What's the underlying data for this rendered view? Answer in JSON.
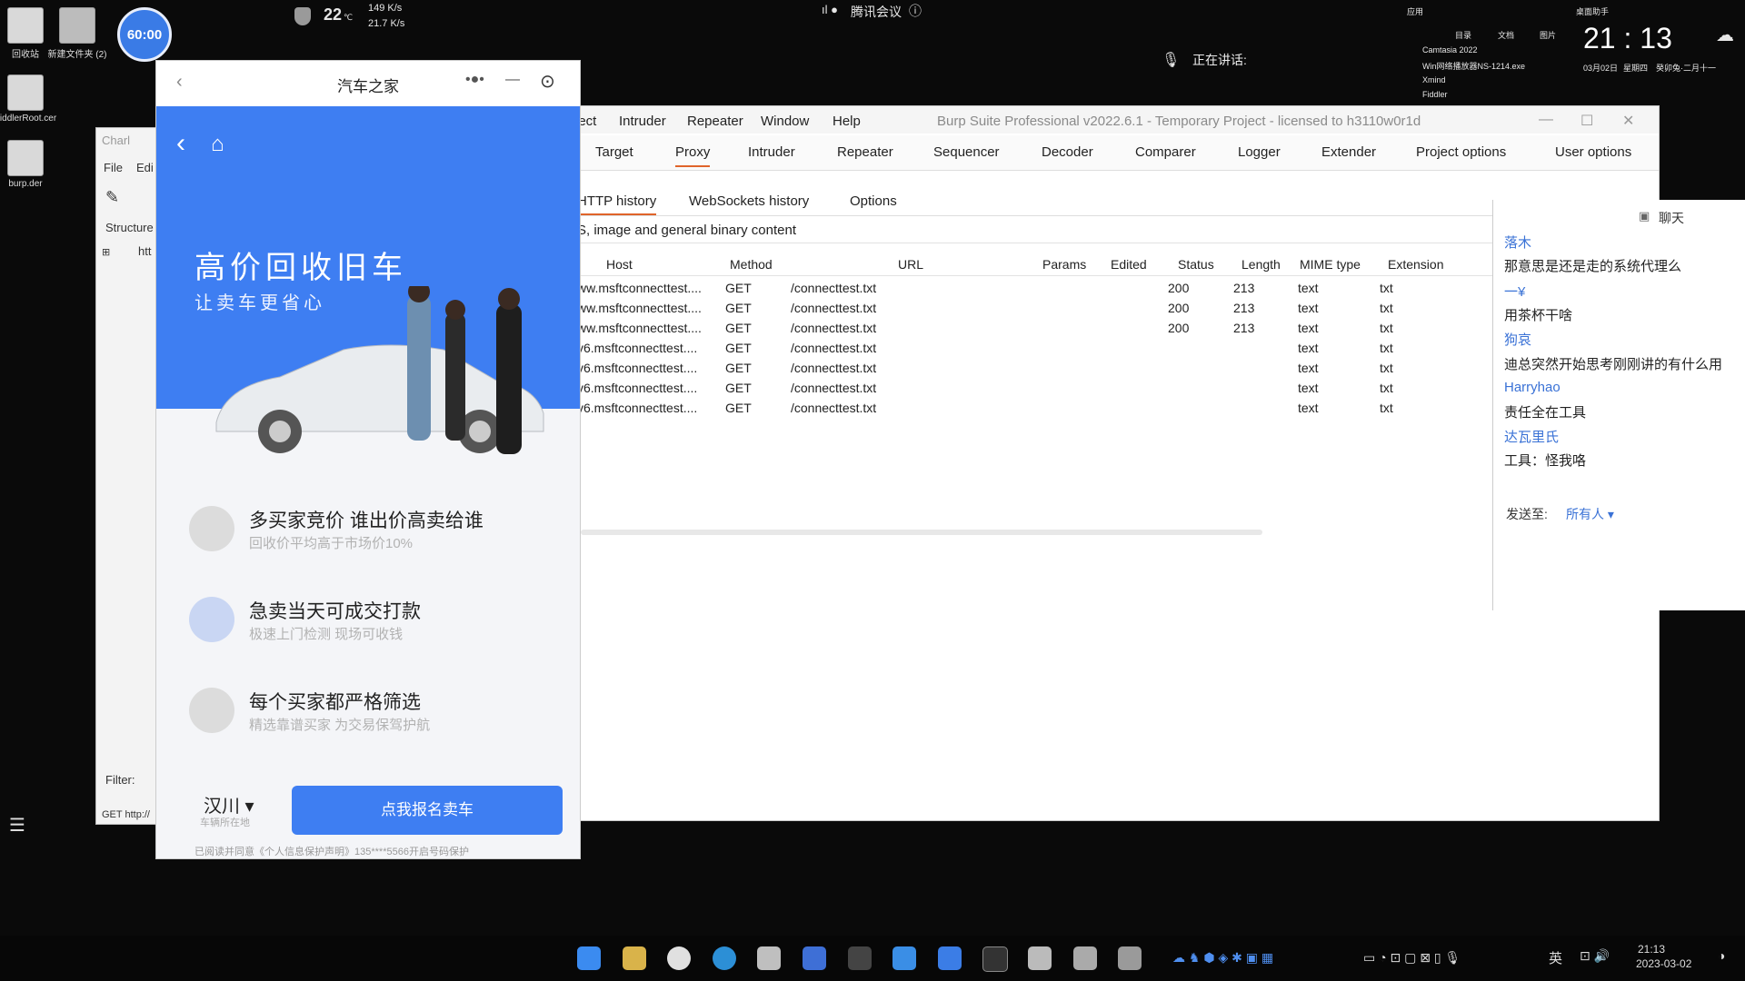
{
  "desktop": {
    "icons": [
      {
        "label": "回收站"
      },
      {
        "label": "新建文件夹 (2)"
      },
      {
        "label": "FiddlerRoot.cer"
      },
      {
        "label": "burp.der"
      }
    ],
    "timer": "60:00",
    "cpu_temp": "22",
    "cpu_unit": "℃",
    "net_up": "149 K/s",
    "net_down": "21.7 K/s",
    "meeting_app": "腾讯会议",
    "speaking_label": "正在讲话:",
    "clock_time": "21 : 13",
    "clock_date": "03月02日",
    "clock_weekday": "星期四",
    "clock_lunar": "癸卯兔·二月十一",
    "recent_apps": [
      "Camtasia 2022",
      "Win网络播放器NS-1214.exe",
      "Xmind",
      "Fiddler"
    ],
    "widget_tabs": [
      "应用",
      "目录",
      "文档",
      "图片",
      "桌面助手"
    ]
  },
  "charles": {
    "title": "Charl",
    "menu": [
      "File",
      "Edi"
    ],
    "structure_label": "Structure",
    "tree_item": "htt",
    "filter_label": "Filter:",
    "status": "GET http://"
  },
  "burp": {
    "menu": [
      "ject",
      "Intruder",
      "Repeater",
      "Window",
      "Help"
    ],
    "title": "Burp Suite Professional v2022.6.1 - Temporary Project - licensed to h3110w0r1d",
    "tabs": [
      "Target",
      "Proxy",
      "Intruder",
      "Repeater",
      "Sequencer",
      "Decoder",
      "Comparer",
      "Logger",
      "Extender",
      "Project options",
      "User options"
    ],
    "active_tab": "Proxy",
    "subtabs": [
      "HTTP history",
      "WebSockets history",
      "Options"
    ],
    "filter_text": "S, image and general binary content",
    "columns": [
      "Host",
      "Method",
      "URL",
      "Params",
      "Edited",
      "Status",
      "Length",
      "MIME type",
      "Extension"
    ],
    "rows": [
      {
        "host": "ww.msftconnecttest....",
        "method": "GET",
        "url": "/connecttest.txt",
        "status": "200",
        "length": "213",
        "mime": "text",
        "ext": "txt"
      },
      {
        "host": "ww.msftconnecttest....",
        "method": "GET",
        "url": "/connecttest.txt",
        "status": "200",
        "length": "213",
        "mime": "text",
        "ext": "txt"
      },
      {
        "host": "ww.msftconnecttest....",
        "method": "GET",
        "url": "/connecttest.txt",
        "status": "200",
        "length": "213",
        "mime": "text",
        "ext": "txt"
      },
      {
        "host": "v6.msftconnecttest....",
        "method": "GET",
        "url": "/connecttest.txt",
        "status": "",
        "length": "",
        "mime": "text",
        "ext": "txt"
      },
      {
        "host": "v6.msftconnecttest....",
        "method": "GET",
        "url": "/connecttest.txt",
        "status": "",
        "length": "",
        "mime": "text",
        "ext": "txt"
      },
      {
        "host": "v6.msftconnecttest....",
        "method": "GET",
        "url": "/connecttest.txt",
        "status": "",
        "length": "",
        "mime": "text",
        "ext": "txt"
      },
      {
        "host": "v6.msftconnecttest....",
        "method": "GET",
        "url": "/connecttest.txt",
        "status": "",
        "length": "",
        "mime": "text",
        "ext": "txt"
      }
    ]
  },
  "chat": {
    "title": "聊天",
    "messages": [
      {
        "name": "落木",
        "text": "那意思是还是走的系统代理么"
      },
      {
        "name": "一¥",
        "text": "用茶杯干啥"
      },
      {
        "name": "狗哀",
        "text": "迪总突然开始思考刚刚讲的有什么用"
      },
      {
        "name": "Harryhao",
        "text": "责任全在工具"
      },
      {
        "name": "达瓦里氏",
        "text": "工具：怪我咯"
      }
    ],
    "send_to_label": "发送至:",
    "send_to_value": "所有人 ▾"
  },
  "phone": {
    "title": "汽车之家",
    "hero_title": "高价回收旧车",
    "hero_subtitle": "让卖车更省心",
    "features": [
      {
        "title": "多买家竞价 谁出价高卖给谁",
        "subtitle": "回收价平均高于市场价10%"
      },
      {
        "title": "急卖当天可成交打款",
        "subtitle": "极速上门检测 现场可收钱"
      },
      {
        "title": "每个买家都严格筛选",
        "subtitle": "精选靠谱买家 为交易保驾护航"
      }
    ],
    "city": "汉川 ▾",
    "city_caption": "车辆所在地",
    "cta": "点我报名卖车",
    "privacy": "已阅读并同意《个人信息保护声明》135****5566开启号码保护"
  },
  "taskbar": {
    "ime": "英",
    "time": "21:13",
    "date": "2023-03-02"
  }
}
